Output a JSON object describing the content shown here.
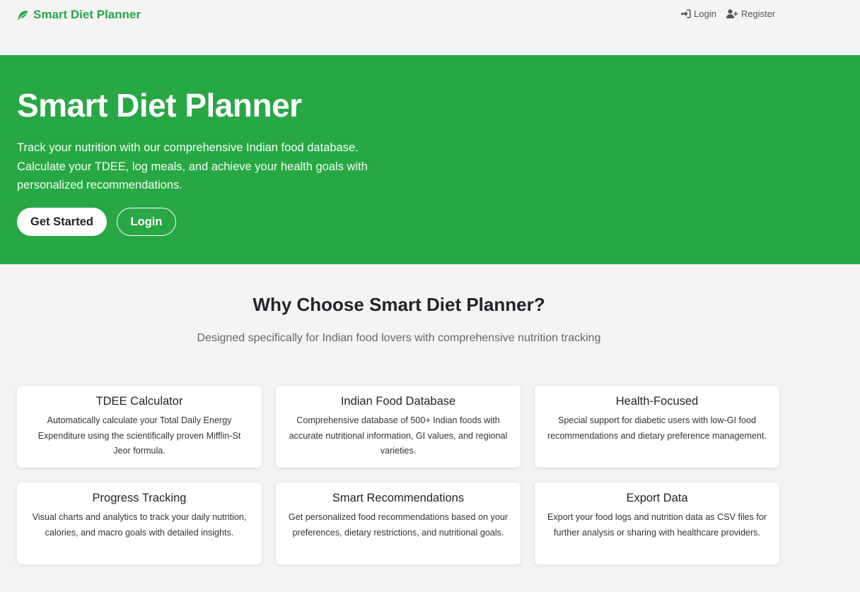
{
  "nav": {
    "brand": "Smart Diet Planner",
    "login": "Login",
    "register": "Register"
  },
  "hero": {
    "title": "Smart Diet Planner",
    "lead": "Track your nutrition with our comprehensive Indian food database. Calculate your TDEE, log meals, and achieve your health goals with personalized recommendations.",
    "get_started": "Get Started",
    "login": "Login"
  },
  "features": {
    "title": "Why Choose Smart Diet Planner?",
    "subtitle": "Designed specifically for Indian food lovers with comprehensive nutrition tracking",
    "cards": [
      {
        "title": "TDEE Calculator",
        "text": "Automatically calculate your Total Daily Energy Expenditure using the scientifically proven Mifflin-St Jeor formula."
      },
      {
        "title": "Indian Food Database",
        "text": "Comprehensive database of 500+ Indian foods with accurate nutritional information, GI values, and regional varieties."
      },
      {
        "title": "Health-Focused",
        "text": "Special support for diabetic users with low-GI food recommendations and dietary preference management."
      },
      {
        "title": "Progress Tracking",
        "text": "Visual charts and analytics to track your daily nutrition, calories, and macro goals with detailed insights."
      },
      {
        "title": "Smart Recommendations",
        "text": "Get personalized food recommendations based on your preferences, dietary restrictions, and nutritional goals."
      },
      {
        "title": "Export Data",
        "text": "Export your food logs and nutrition data as CSV files for further analysis or sharing with healthcare providers."
      }
    ]
  },
  "colors": {
    "brand_green": "#28a745",
    "page_bg": "#f4f4f4"
  },
  "icons": {
    "brand": "leaf-icon",
    "login": "sign-in-icon",
    "register": "user-plus-icon"
  }
}
